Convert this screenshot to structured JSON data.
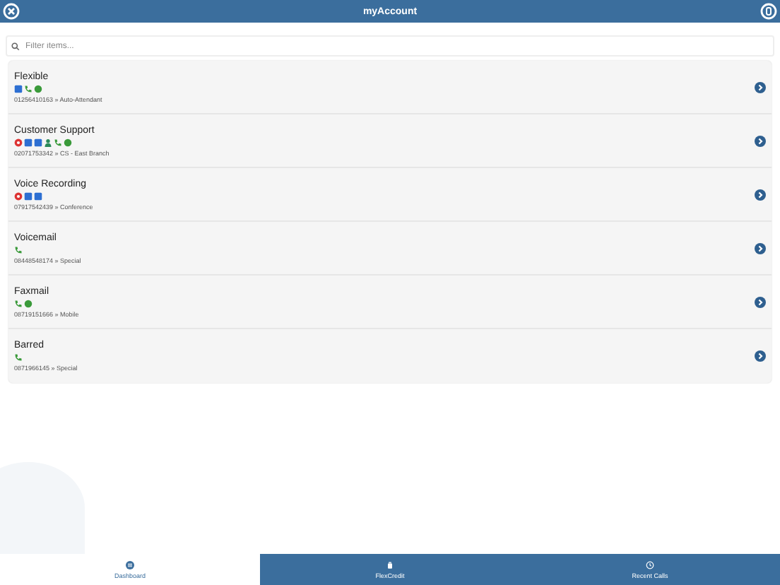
{
  "header": {
    "title": "myAccount"
  },
  "search": {
    "placeholder": "Filter items..."
  },
  "numbers": [
    {
      "name": "Flexible",
      "icons": [
        {
          "kind": "blue"
        },
        {
          "kind": "phone"
        },
        {
          "kind": "green"
        }
      ],
      "detail": "01256410163 » Auto-Attendant"
    },
    {
      "name": "Customer Support",
      "icons": [
        {
          "kind": "red"
        },
        {
          "kind": "blue"
        },
        {
          "kind": "blue"
        },
        {
          "kind": "user"
        },
        {
          "kind": "phone"
        },
        {
          "kind": "green"
        }
      ],
      "detail": "02071753342 » CS - East Branch"
    },
    {
      "name": "Voice Recording",
      "icons": [
        {
          "kind": "red"
        },
        {
          "kind": "blue"
        },
        {
          "kind": "blue"
        }
      ],
      "detail": "07917542439 » Conference"
    },
    {
      "name": "Voicemail",
      "icons": [
        {
          "kind": "phone"
        }
      ],
      "detail": "08448548174 » Special"
    },
    {
      "name": "Faxmail",
      "icons": [
        {
          "kind": "phone"
        },
        {
          "kind": "green"
        }
      ],
      "detail": "08719151666 » Mobile"
    },
    {
      "name": "Barred",
      "icons": [
        {
          "kind": "phone"
        }
      ],
      "detail": "0871966145 » Special"
    }
  ],
  "tabs": [
    {
      "label": "Dashboard",
      "kind": "grid",
      "selected": true
    },
    {
      "label": "FlexCredit",
      "kind": "bag",
      "selected": false
    },
    {
      "label": "Recent Calls",
      "kind": "clock",
      "selected": false
    }
  ]
}
